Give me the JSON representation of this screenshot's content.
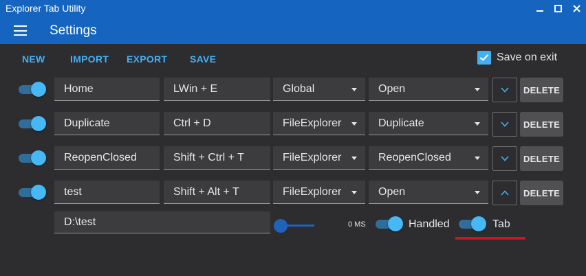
{
  "window": {
    "title": "Explorer Tab Utility"
  },
  "header": {
    "title": "Settings"
  },
  "toolbar": {
    "new_label": "NEW",
    "import_label": "IMPORT",
    "export_label": "EXPORT",
    "save_label": "SAVE",
    "save_on_exit": {
      "label": "Save on exit",
      "checked": true
    }
  },
  "hotkeys": [
    {
      "enabled": true,
      "name": "Home",
      "keys": "LWin + E",
      "scope": "Global",
      "action": "Open",
      "expanded": false,
      "delete_label": "DELETE"
    },
    {
      "enabled": true,
      "name": "Duplicate",
      "keys": "Ctrl + D",
      "scope": "FileExplorer",
      "action": "Duplicate",
      "expanded": false,
      "delete_label": "DELETE"
    },
    {
      "enabled": true,
      "name": "ReopenClosed",
      "keys": "Shift + Ctrl + T",
      "scope": "FileExplorer",
      "action": "ReopenClosed",
      "expanded": false,
      "delete_label": "DELETE"
    },
    {
      "enabled": true,
      "name": "test",
      "keys": "Shift + Alt + T",
      "scope": "FileExplorer",
      "action": "Open",
      "expanded": true,
      "delete_label": "DELETE"
    }
  ],
  "details": {
    "path": "D:\\test",
    "delay_label": "0 MS",
    "delay_fraction": 0,
    "handled": {
      "label": "Handled",
      "on": true
    },
    "tab": {
      "label": "Tab",
      "on": true
    }
  },
  "colors": {
    "accent": "#1565c0",
    "toggle_thumb": "#45b8f5",
    "annotation": "#d0121a"
  },
  "icons": [
    "menu-icon",
    "minimize-icon",
    "maximize-icon",
    "close-icon",
    "checkmark-icon",
    "chevron-down-icon",
    "chevron-up-icon"
  ]
}
